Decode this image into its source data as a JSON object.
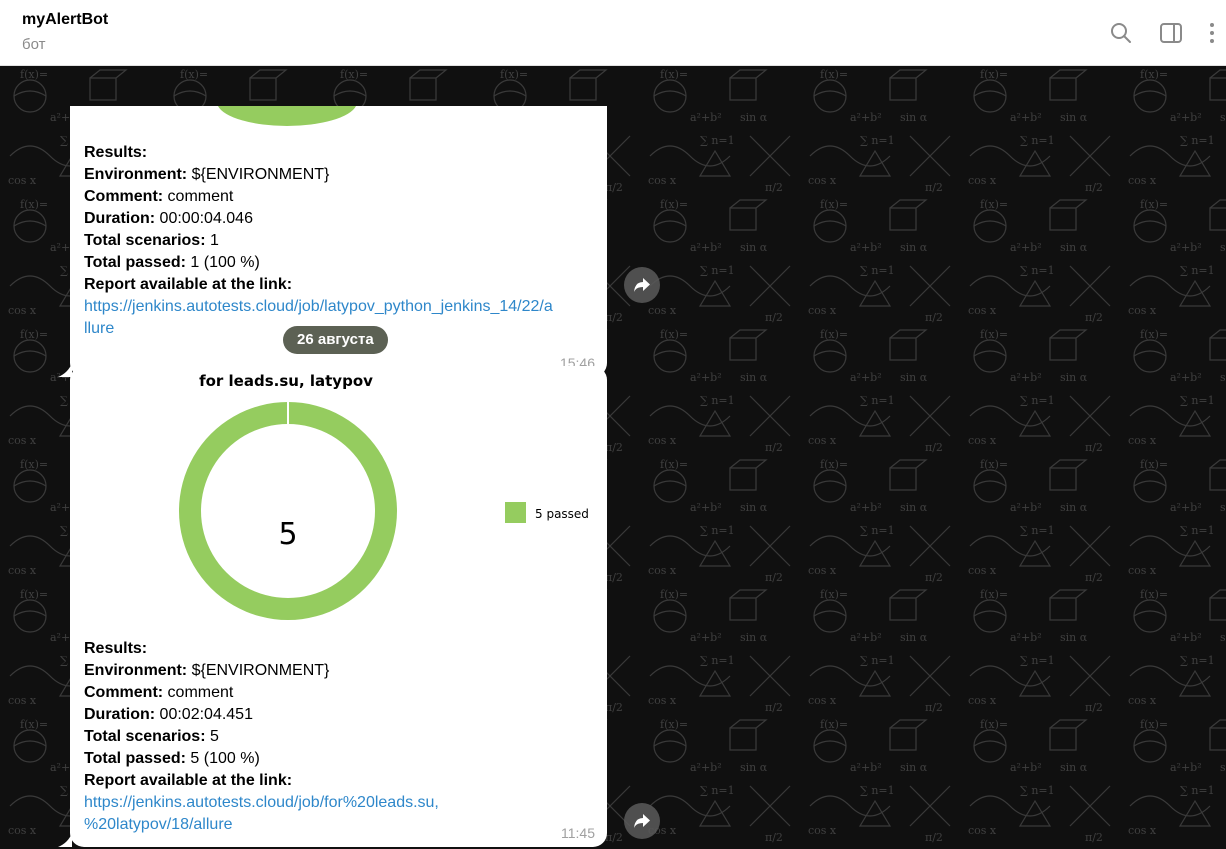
{
  "header": {
    "title": "myAlertBot",
    "subtitle": "бот",
    "icons": [
      "search-icon",
      "sidebar-toggle-icon",
      "more-vertical-icon"
    ]
  },
  "date_separator": "26 августа",
  "messages": [
    {
      "results_label": "Results:",
      "environment_label": "Environment:",
      "environment_value": " ${ENVIRONMENT}",
      "comment_label": "Comment:",
      "comment_value": " comment",
      "duration_label": "Duration:",
      "duration_value": " 00:00:04.046",
      "scenarios_label": "Total scenarios:",
      "scenarios_value": " 1",
      "passed_label": "Total passed:",
      "passed_value": " 1 (100 %)",
      "report_label": "Report available at the link:",
      "link_line1": "https://jenkins.autotests.cloud/job/latypov_python_jenkins_14/22/a",
      "link_line2": "llure",
      "time": "15:46"
    },
    {
      "chart_title": "for leads.su, latypov",
      "chart_center": "5",
      "legend_label": "5 passed",
      "results_label": "Results:",
      "environment_label": "Environment:",
      "environment_value": " ${ENVIRONMENT}",
      "comment_label": "Comment:",
      "comment_value": " comment",
      "duration_label": "Duration:",
      "duration_value": " 00:02:04.451",
      "scenarios_label": "Total scenarios:",
      "scenarios_value": " 5",
      "passed_label": "Total passed:",
      "passed_value": " 5 (100 %)",
      "report_label": "Report available at the link:",
      "link_line1": "https://jenkins.autotests.cloud/job/for%20leads.su,",
      "link_line2": "%20latypov/18/allure",
      "time": "11:45"
    }
  ],
  "chart_data": {
    "type": "pie",
    "title": "for leads.su, latypov",
    "categories": [
      "5 passed"
    ],
    "values": [
      5
    ],
    "colors": [
      "#95cc5f"
    ]
  },
  "colors": {
    "accent_link": "#2e87ca",
    "passed_green": "#95cc5f",
    "header_bg": "#ffffff",
    "chat_bg": "#101010"
  }
}
